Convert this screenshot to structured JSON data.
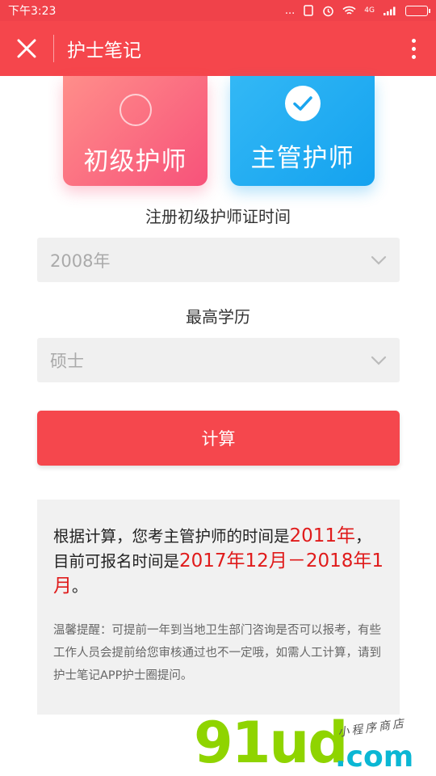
{
  "status_bar": {
    "time": "下午3:23",
    "dots": "...",
    "net": "4G"
  },
  "header": {
    "title": "护士笔记"
  },
  "cards": [
    {
      "label": "初级护师",
      "selected": false,
      "icon": "radio-empty-icon"
    },
    {
      "label": "主管护师",
      "selected": true,
      "icon": "check-icon"
    }
  ],
  "form": {
    "cert_time_label": "注册初级护师证时间",
    "cert_time_value": "2008年",
    "education_label": "最高学历",
    "education_value": "硕士"
  },
  "calculate_label": "计算",
  "result": {
    "part1": "根据计算，您考主管护师的时间是",
    "exam_year": "2011年",
    "part2": "，目前可报名时间是",
    "signup_period": "2017年12月－2018年1月",
    "part3": "。",
    "tip": "温馨提醒：可提前一年到当地卫生部门咨询是否可以报考，有些工作人员会提前给您审核通过也不一定哦，如需人工计算，请到护士笔记APP护士圈提问。"
  },
  "watermark": {
    "main": "91ud",
    "suffix": ".com",
    "sub": "小程序商店"
  },
  "colors": {
    "header_red": "#f5464c",
    "highlight_red": "#e01b1b",
    "junior_gradient": [
      "#ff8e8a",
      "#f7527a"
    ],
    "senior_gradient": [
      "#33b8f5",
      "#14a2ef"
    ]
  }
}
